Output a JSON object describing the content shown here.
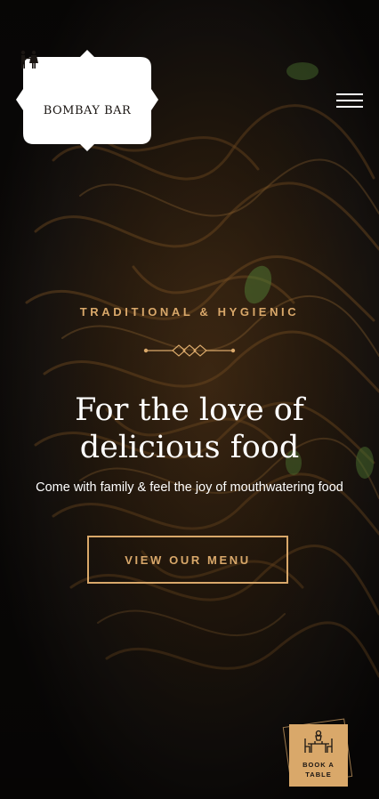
{
  "brand": {
    "name": "BOMBAY BAR"
  },
  "hero": {
    "eyebrow": "TRADITIONAL & HYGIENIC",
    "title_line1": "For the love of",
    "title_line2": "delicious food",
    "subtitle": "Come with family & feel the joy of mouthwatering food",
    "cta_label": "VIEW OUR MENU"
  },
  "book_table": {
    "line1": "BOOK A",
    "line2": "TABLE"
  },
  "icons": {
    "menu": "hamburger-icon",
    "logo_mark": "couple-icon",
    "book": "dining-table-icon",
    "divider": "ornament-divider"
  },
  "colors": {
    "accent": "#d9a86a",
    "text_light": "#ffffff",
    "logo_bg": "#ffffff",
    "dark": "#1a1512"
  }
}
